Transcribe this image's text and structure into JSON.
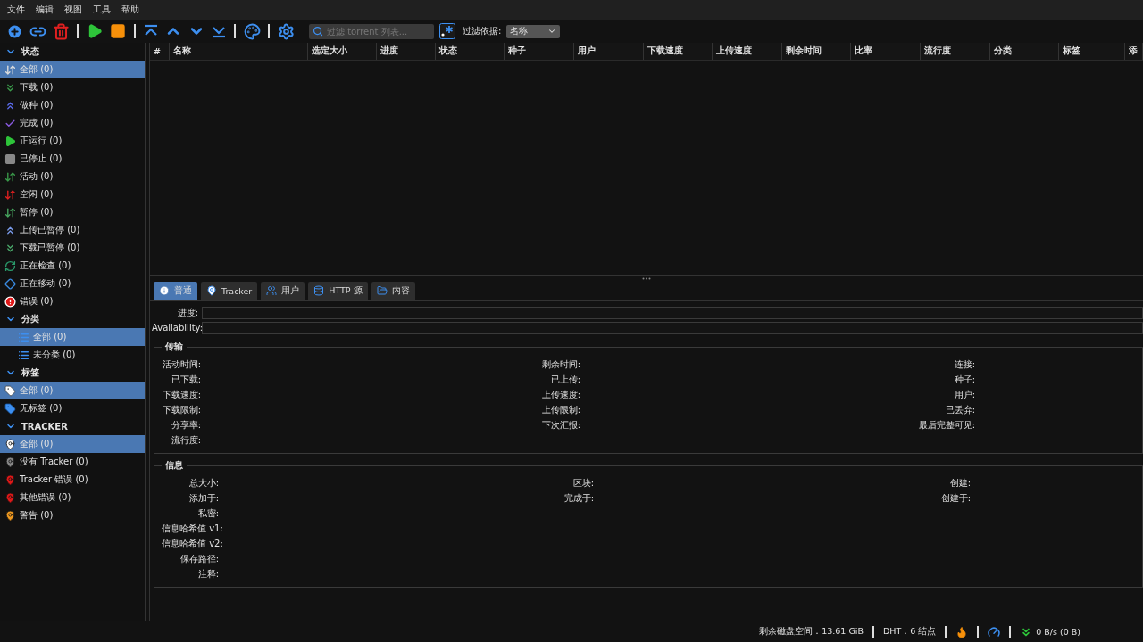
{
  "menu": [
    "文件",
    "编辑",
    "视图",
    "工具",
    "帮助"
  ],
  "toolbar": {
    "search": {
      "placeholder": "过滤 torrent 列表..."
    },
    "filter_label": "过滤依据:",
    "filter_by": "名称"
  },
  "sidebar": [
    {
      "title": "状态",
      "expanded": true,
      "items": [
        {
          "label": "全部 (0)",
          "selected": true
        },
        {
          "label": "下载 (0)",
          "selected": false
        },
        {
          "label": "做种 (0)",
          "selected": false
        },
        {
          "label": "完成 (0)",
          "selected": false
        },
        {
          "label": "正运行 (0)",
          "selected": false
        },
        {
          "label": "已停止 (0)",
          "selected": false
        },
        {
          "label": "活动 (0)",
          "selected": false
        },
        {
          "label": "空闲 (0)",
          "selected": false
        },
        {
          "label": "暂停 (0)",
          "selected": false
        },
        {
          "label": "上传已暂停 (0)",
          "selected": false
        },
        {
          "label": "下载已暂停 (0)",
          "selected": false
        },
        {
          "label": "正在检查 (0)",
          "selected": false
        },
        {
          "label": "正在移动 (0)",
          "selected": false
        },
        {
          "label": "错误 (0)",
          "selected": false
        }
      ]
    },
    {
      "title": "分类",
      "expanded": true,
      "items": [
        {
          "label": "全部 (0)",
          "selected": true
        },
        {
          "label": "未分类 (0)",
          "selected": false
        }
      ]
    },
    {
      "title": "标签",
      "expanded": true,
      "items": [
        {
          "label": "全部 (0)",
          "selected": true
        },
        {
          "label": "无标签 (0)",
          "selected": false
        }
      ]
    },
    {
      "title": "TRACKER",
      "expanded": true,
      "items": [
        {
          "label": "全部 (0)",
          "selected": true
        },
        {
          "label": "没有 Tracker (0)",
          "selected": false
        },
        {
          "label": "Tracker 错误 (0)",
          "selected": false
        },
        {
          "label": "其他错误 (0)",
          "selected": false
        },
        {
          "label": "警告 (0)",
          "selected": false
        }
      ]
    }
  ],
  "table": {
    "columns": [
      "#",
      "名称",
      "选定大小",
      "进度",
      "状态",
      "种子",
      "用户",
      "下载速度",
      "上传速度",
      "剩余时间",
      "比率",
      "流行度",
      "分类",
      "标签",
      "添"
    ]
  },
  "details": {
    "tabs": [
      {
        "label": "普通",
        "selected": true
      },
      {
        "label": "Tracker",
        "selected": false
      },
      {
        "label": "用户",
        "selected": false
      },
      {
        "label": "HTTP 源",
        "selected": false
      },
      {
        "label": "内容",
        "selected": false
      }
    ],
    "bars": [
      {
        "label": "进度:",
        "level": 0
      },
      {
        "label": "Availability:",
        "level": 0
      }
    ],
    "groups": [
      {
        "title": "传输",
        "columns": [
          [
            "活动时间:",
            "已下载:",
            "下载速度:",
            "下载限制:",
            "分享率:",
            "流行度:"
          ],
          [
            "剩余时间:",
            "已上传:",
            "上传速度:",
            "上传限制:",
            "下次汇报:"
          ],
          [
            "连接:",
            "种子:",
            "用户:",
            "已丢弃:",
            "最后完整可见:"
          ]
        ]
      },
      {
        "title": "信息",
        "columns": [
          [
            "总大小:",
            "添加于:",
            "私密:",
            "信息哈希值 v1:",
            "信息哈希值 v2:",
            "保存路径:",
            "注释:"
          ],
          [
            "区块:",
            "完成于:"
          ],
          [
            "创建:",
            "创建于:"
          ]
        ]
      }
    ]
  },
  "status_bar": {
    "free_space": "剩余磁盘空间：13.61 GiB",
    "dht": "DHT：6 结点",
    "speed": "0 B/s (0 B)"
  }
}
